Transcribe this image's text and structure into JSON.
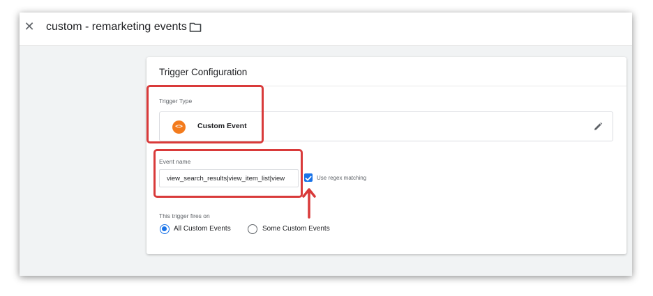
{
  "header": {
    "close_icon": "close-icon",
    "tag_name": "custom - remarketing events",
    "folder_icon": "folder-icon"
  },
  "card": {
    "title": "Trigger Configuration",
    "trigger_type": {
      "label": "Trigger Type",
      "value": "Custom Event",
      "icon": "custom-event-icon",
      "icon_glyph": "<>",
      "edit_icon": "pencil-icon"
    },
    "event_name": {
      "label": "Event name",
      "value": "view_search_results|view_item_list|view",
      "regex_label": "Use regex matching",
      "regex_checked": true
    },
    "fires_on": {
      "label": "This trigger fires on",
      "options": [
        "All Custom Events",
        "Some Custom Events"
      ],
      "selected": "All Custom Events"
    }
  },
  "colors": {
    "accent": "#1a73e8",
    "custom_event_icon": "#f37b1d",
    "annotation": "#d93a3a"
  }
}
